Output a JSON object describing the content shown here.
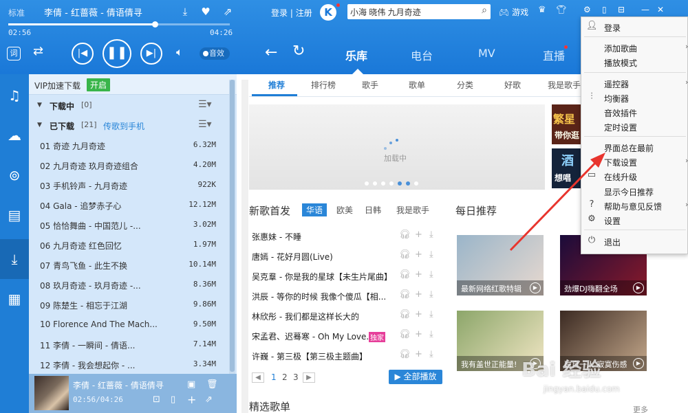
{
  "player": {
    "quality": "标准",
    "song_title": "李倩 - 红蔷薇 - 倩语倩寻",
    "current_time": "02:56",
    "total_time": "04:26",
    "progress": 0.66,
    "lyric_btn": "词",
    "effect_label": "音效"
  },
  "header": {
    "login": "登录",
    "register": "注册",
    "logo": "K",
    "search_value": "小海 晓伟 九月奇迹",
    "game_label": "游戏"
  },
  "nav_tabs": [
    "乐库",
    "电台",
    "MV",
    "直播"
  ],
  "sub_tabs": [
    "推荐",
    "排行榜",
    "歌手",
    "歌单",
    "分类",
    "好歌",
    "我是歌手"
  ],
  "list_panel": {
    "vip_label": "VIP加速下载",
    "vip_btn": "开启",
    "group_downloading": {
      "name": "下载中",
      "count": "[0]"
    },
    "group_downloaded": {
      "name": "已下载",
      "count": "[21]",
      "link": "传歌到手机"
    },
    "songs": [
      {
        "name": "01 奇迹 九月奇迹",
        "size": "6.32M"
      },
      {
        "name": "02 九月奇迹 玖月奇迹组合",
        "size": "4.20M"
      },
      {
        "name": "03 手机铃声 - 九月奇迹",
        "size": "922K"
      },
      {
        "name": "04 Gala - 追梦赤子心",
        "size": "12.12M"
      },
      {
        "name": "05 恰恰舞曲 - 中国范儿 -...",
        "size": "3.02M"
      },
      {
        "name": "06 九月奇迹 红色回忆",
        "size": "1.97M"
      },
      {
        "name": "07 青鸟飞鱼 - 此生不换",
        "size": "10.14M"
      },
      {
        "name": "08 玖月奇迹 - 玖月奇迹 -...",
        "size": "8.36M"
      },
      {
        "name": "09 陈楚生 - 相忘于江湖",
        "size": "9.86M"
      },
      {
        "name": "10 Florence And The Mach...",
        "size": "9.50M"
      },
      {
        "name": "11 李倩 - 一瞬间 - 倩语...",
        "size": "7.14M"
      },
      {
        "name": "12 李倩 - 我会想起你 - ...",
        "size": "3.34M"
      }
    ],
    "now_playing": {
      "title": "李倩 - 红蔷薇 - 倩语倩寻",
      "time": "02:56/04:26"
    }
  },
  "main": {
    "banner_loading": "加载中",
    "banner_dots": 7,
    "banner_active_dot": 5,
    "new_songs_title": "新歌首发",
    "region_tabs": [
      "华语",
      "欧美",
      "日韩",
      "我是歌手"
    ],
    "new_songs": [
      {
        "title": "张惠妹 - 不睡",
        "vip": ""
      },
      {
        "title": "唐嫣 - 花好月圆(Live)",
        "vip": ""
      },
      {
        "title": "吴克羣 - 你是我的星球【未生片尾曲】",
        "vip": ""
      },
      {
        "title": "洪辰 - 等你的时候 我像个傻瓜【相...",
        "vip": ""
      },
      {
        "title": "林欣彤 - 我们都是这样长大的",
        "vip": ""
      },
      {
        "title": "宋孟君、迟蓦寒 - Oh My Love...",
        "vip": "独家"
      },
      {
        "title": "许巍 - 第三极【第三极主题曲】",
        "vip": ""
      }
    ],
    "pages": [
      "1",
      "2",
      "3"
    ],
    "play_all": "全部播放",
    "daily_title": "每日推荐",
    "daily_cards": [
      {
        "caption": "最新网络红歌特辑",
        "color1": "#9ab5c9",
        "color2": "#e8d9cf"
      },
      {
        "caption": "劲爆DJ嗨翻全场",
        "color1": "#1a0b3a",
        "color2": "#8a1a2a"
      },
      {
        "caption": "我有盖世正能量!",
        "color1": "#8ca66a",
        "color2": "#f1e6c4"
      },
      {
        "caption": "独自一人 寂寞伤感",
        "color1": "#3b2a22",
        "color2": "#c5a98c"
      }
    ],
    "side_ad_1": "繁星",
    "side_ad_1b": "带你逛",
    "side_ad_2": "酒",
    "side_ad_2b": "想唱",
    "playlist_title": "精选歌单",
    "more": "更多"
  },
  "context_menu": {
    "items": [
      {
        "label": "登录",
        "icon": "user-icon",
        "arrow": false
      },
      {
        "label": "添加歌曲",
        "icon": "",
        "arrow": true
      },
      {
        "label": "播放模式",
        "icon": "",
        "arrow": false
      },
      {
        "label": "遥控器",
        "icon": "",
        "arrow": true
      },
      {
        "label": "均衡器",
        "icon": "equalizer-icon",
        "arrow": false
      },
      {
        "label": "音效插件",
        "icon": "",
        "arrow": false
      },
      {
        "label": "定时设置",
        "icon": "",
        "arrow": false
      },
      {
        "label": "界面总在最前",
        "icon": "",
        "arrow": false
      },
      {
        "label": "下载设置",
        "icon": "",
        "arrow": true
      },
      {
        "label": "在线升级",
        "icon": "monitor-icon",
        "arrow": false
      },
      {
        "label": "显示今日推荐",
        "icon": "",
        "arrow": false
      },
      {
        "label": "帮助与意见反馈",
        "icon": "help-icon",
        "arrow": true
      },
      {
        "label": "设置",
        "icon": "gear-icon",
        "arrow": false
      },
      {
        "label": "退出",
        "icon": "power-icon",
        "arrow": false
      }
    ]
  },
  "watermark": {
    "text": "Bai 经验",
    "url": "jingyan.baidu.com"
  },
  "colors": {
    "accent": "#1f7ed6",
    "annotation_arrow": "#e8352e",
    "vip_green": "#39b54a"
  }
}
